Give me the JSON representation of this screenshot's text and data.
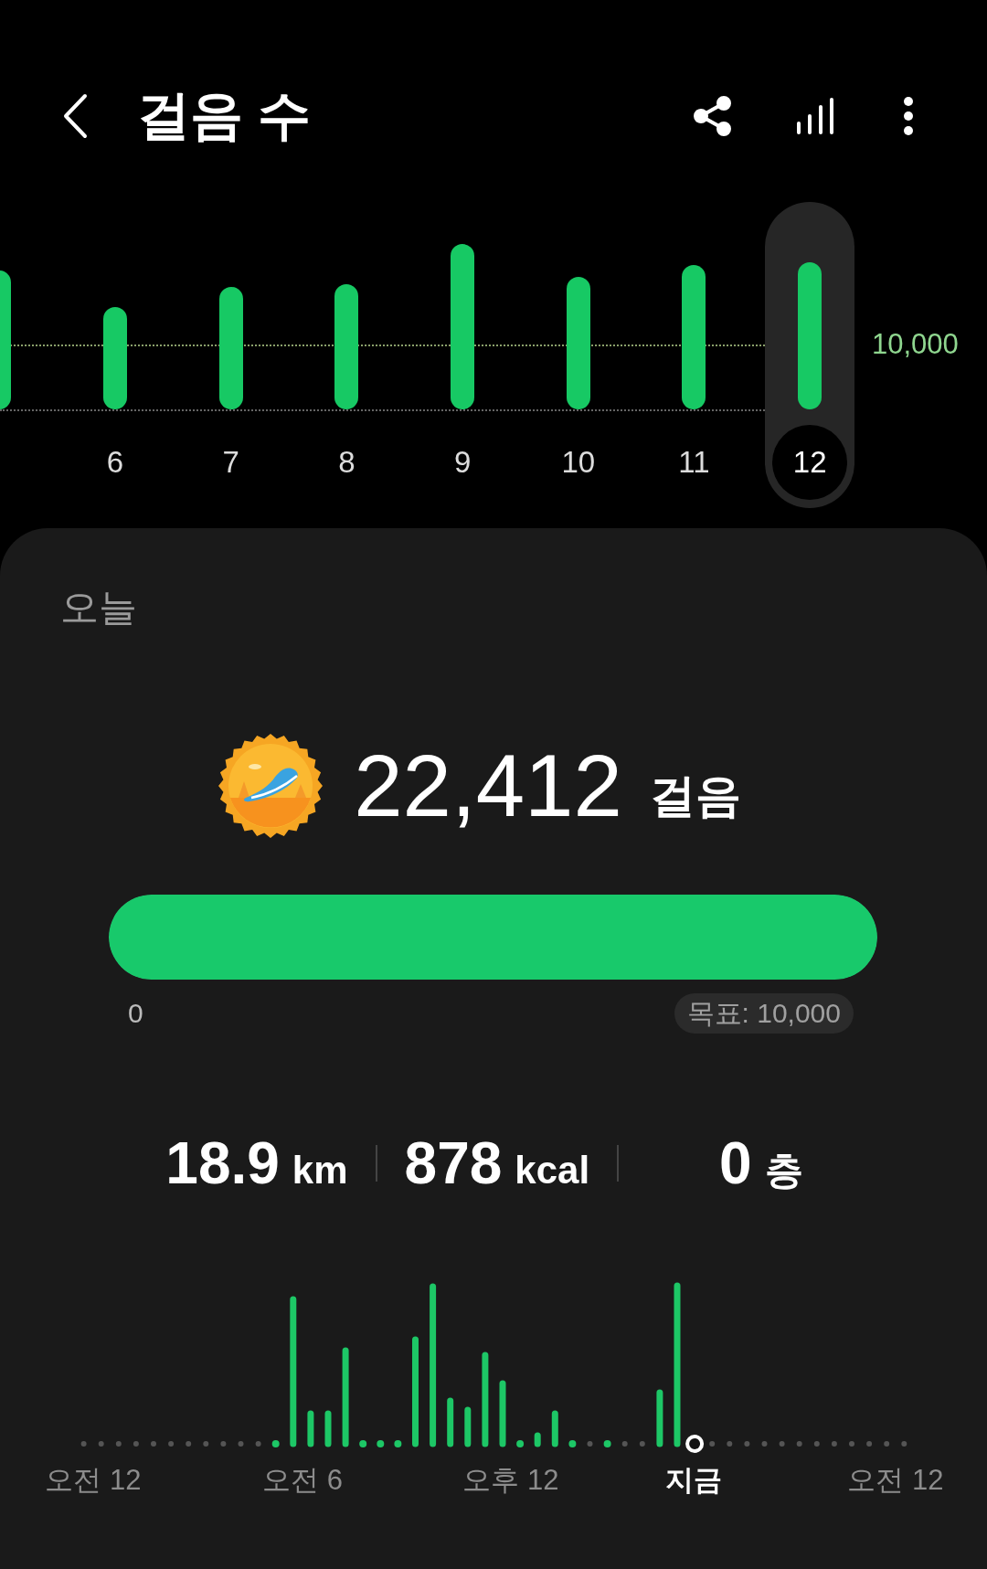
{
  "header": {
    "title": "걸음 수"
  },
  "weekly_chart": {
    "goal_label": "10,000",
    "days": [
      {
        "selected": false
      },
      {
        "label": "6",
        "selected": false
      },
      {
        "label": "7",
        "selected": false
      },
      {
        "label": "8",
        "selected": false
      },
      {
        "label": "9",
        "selected": false
      },
      {
        "label": "10",
        "selected": false
      },
      {
        "label": "11",
        "selected": false
      },
      {
        "label": "12",
        "selected": true
      }
    ]
  },
  "today": {
    "title": "오늘",
    "steps": "22,412",
    "steps_unit": "걸음",
    "progress": {
      "level": 1,
      "start_label": "0",
      "goal_label": "목표: 10,000"
    },
    "stats": [
      {
        "value": "18.9",
        "unit": "km"
      },
      {
        "value": "878",
        "unit": "kcal"
      },
      {
        "value": "0",
        "unit": "층"
      }
    ],
    "hourly_labels": [
      {
        "label": "오전 12",
        "current": false
      },
      {
        "label": "오전 6",
        "current": false
      },
      {
        "label": "오후 12",
        "current": false
      },
      {
        "label": "지금",
        "current": true
      },
      {
        "label": "오전 12",
        "current": false
      }
    ]
  }
}
